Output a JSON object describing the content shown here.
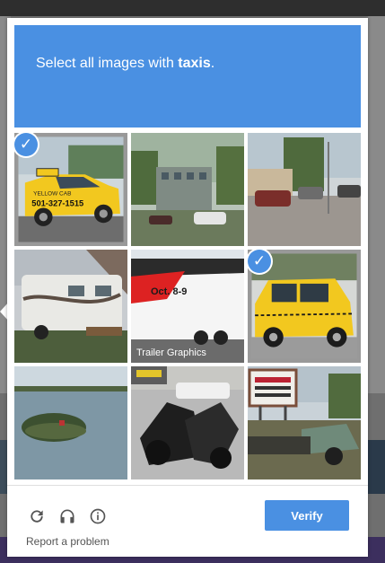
{
  "dialog": {
    "instruction_prefix": "Select all images with ",
    "instruction_target": "taxis",
    "instruction_suffix": "."
  },
  "tiles": [
    {
      "subject": "yellow taxi cab with phone number",
      "selected": true,
      "sign_text": "501-327-1515",
      "sign_text2": "YELLOW CAB"
    },
    {
      "subject": "parking lot with building and trees",
      "selected": false
    },
    {
      "subject": "parking lot with red cars",
      "selected": false
    },
    {
      "subject": "RV camper trailer",
      "selected": false
    },
    {
      "subject": "trailer graphics truck",
      "selected": false,
      "sign_text": "Oct. 8-9",
      "sign_text2": "Trailer Graphics"
    },
    {
      "subject": "yellow checker taxi",
      "selected": true
    },
    {
      "subject": "island in lake",
      "selected": false
    },
    {
      "subject": "motorcycles parked",
      "selected": false
    },
    {
      "subject": "old truck with sign",
      "selected": false
    }
  ],
  "footer": {
    "reload_icon": "reload-icon",
    "audio_icon": "headphones-icon",
    "info_icon": "info-icon",
    "report_label": "Report a problem",
    "verify_label": "Verify"
  },
  "colors": {
    "accent": "#4a90e2",
    "taxi_yellow": "#f2c81f"
  }
}
